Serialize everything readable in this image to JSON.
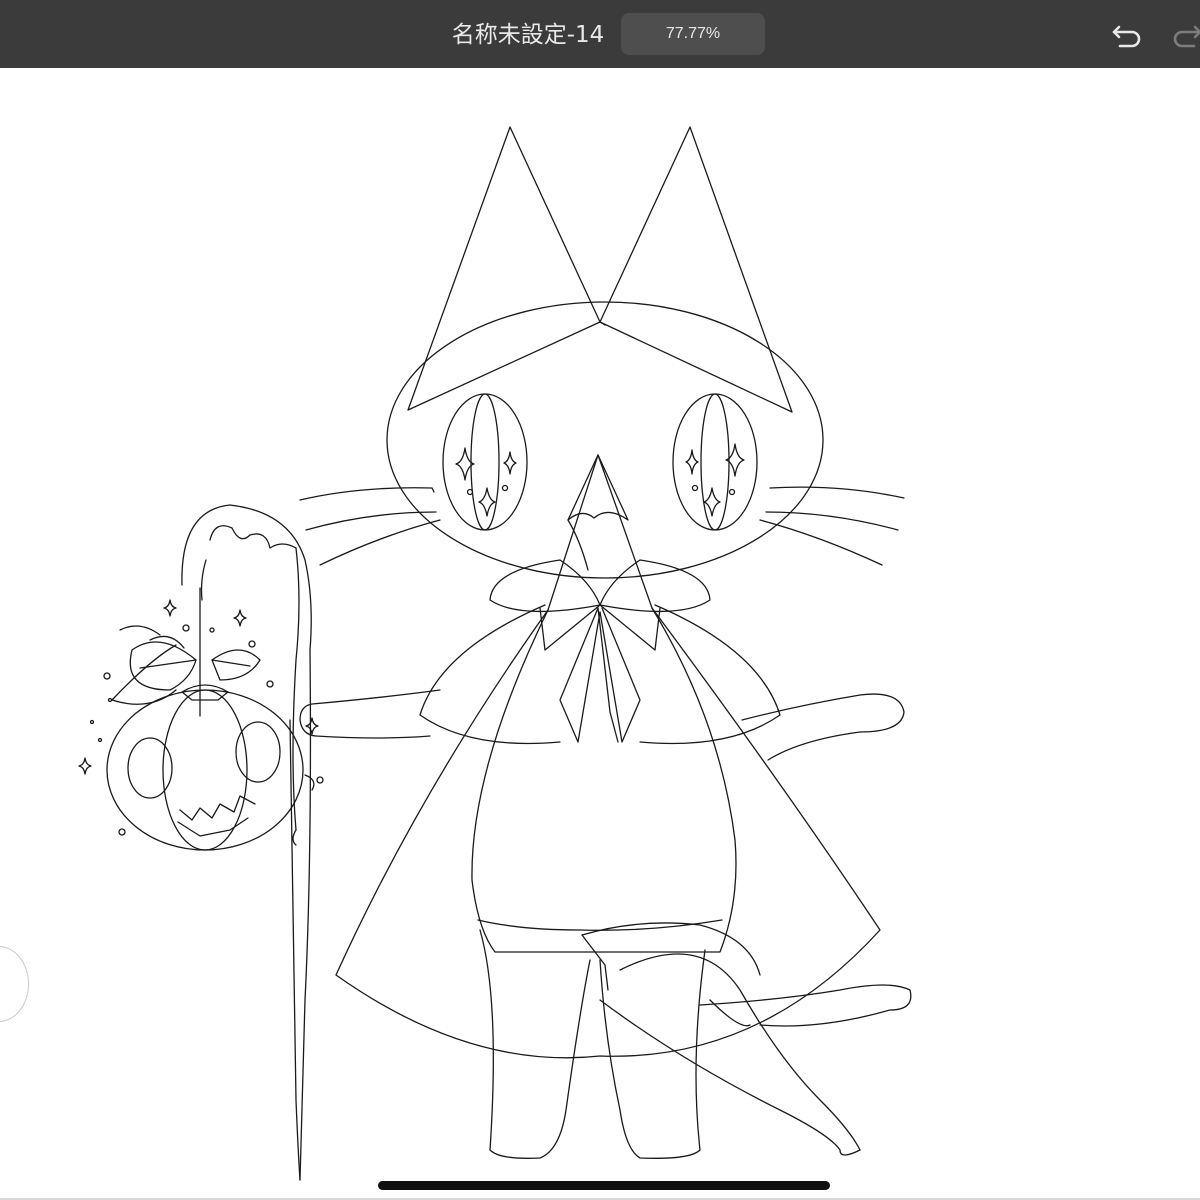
{
  "topbar": {
    "document_title": "名称未設定-14",
    "zoom_level": "77.77%",
    "undo_icon": "undo-arrow-icon",
    "redo_icon": "redo-arrow-icon"
  },
  "canvas": {
    "content": "line-art-drawing"
  },
  "colors": {
    "toolbar_bg": "#3b3b3b",
    "zoom_pill_bg": "#4e4e4e",
    "toolbar_text": "#e8e8e8",
    "canvas_bg": "#ffffff",
    "stroke": "#1a1a1a"
  }
}
